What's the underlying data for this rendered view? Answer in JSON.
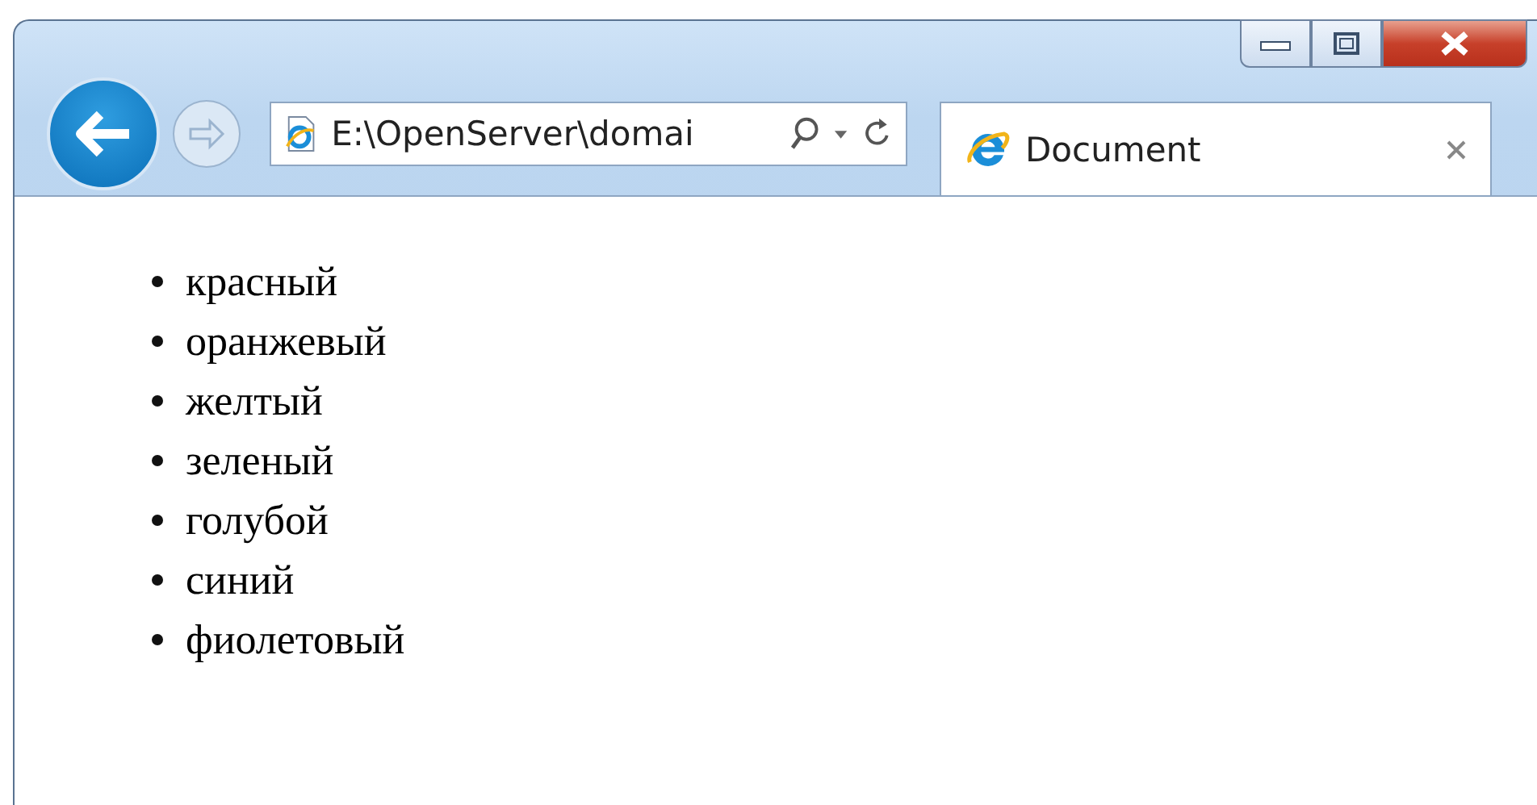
{
  "address_bar": {
    "value": "E:\\OpenServer\\domai"
  },
  "tabs": [
    {
      "label": "Document",
      "selected": true
    }
  ],
  "page": {
    "list_items": [
      "красный",
      "оранжевый",
      "желтый",
      "зеленый",
      "голубой",
      "синий",
      "фиолетовый"
    ]
  }
}
